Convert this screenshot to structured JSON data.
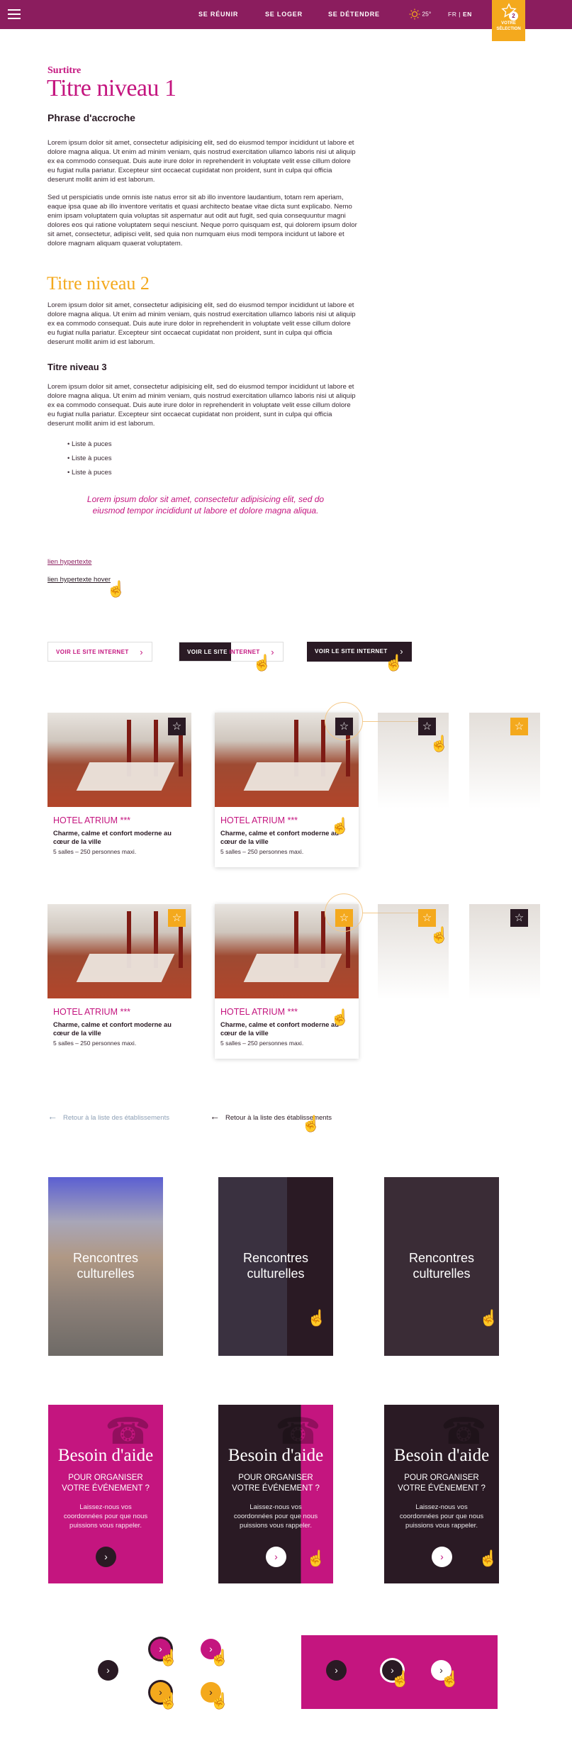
{
  "header": {
    "nav": [
      "SE RÉUNIR",
      "SE LOGER",
      "SE DÉTENDRE"
    ],
    "weather": "25°",
    "lang_fr": "FR",
    "lang_sep": "|",
    "lang_en": "EN",
    "selection_line1": "VOTRE",
    "selection_line2": "SÉLECTION",
    "selection_count": "2"
  },
  "content": {
    "surtitre": "Surtitre",
    "h1": "Titre niveau 1",
    "accroche": "Phrase d'accroche",
    "p1": "Lorem ipsum dolor sit amet, consectetur adipisicing elit, sed do eiusmod tempor incididunt ut labore et dolore magna aliqua. Ut enim ad minim veniam, quis nostrud exercitation ullamco laboris nisi ut aliquip ex ea commodo consequat. Duis aute irure dolor in reprehenderit in voluptate velit esse cillum dolore eu fugiat nulla pariatur. Excepteur sint occaecat cupidatat non proident, sunt in culpa qui officia deserunt mollit anim id est laborum.",
    "p2": "Sed ut perspiciatis unde omnis iste natus error sit ab illo inventore laudantium, totam rem aperiam, eaque ipsa quae ab illo inventore veritatis et quasi architecto beatae vitae dicta sunt explicabo. Nemo enim ipsam voluptatem quia voluptas sit aspernatur aut odit aut fugit, sed quia consequuntur magni dolores eos qui ratione voluptatem sequi nesciunt. Neque porro quisquam est, qui dolorem ipsum dolor sit amet, consectetur, adipisci velit, sed quia non numquam eius modi tempora incidunt ut labore et dolore magnam aliquam quaerat voluptatem.",
    "h2": "Titre niveau 2",
    "p3": "Lorem ipsum dolor sit amet, consectetur adipisicing elit, sed do eiusmod tempor incididunt ut labore et dolore magna aliqua. Ut enim ad minim veniam, quis nostrud exercitation ullamco laboris nisi ut aliquip ex ea commodo consequat. Duis aute irure dolor in reprehenderit in voluptate velit esse cillum dolore eu fugiat nulla pariatur. Excepteur sint occaecat cupidatat non proident, sunt in culpa qui officia deserunt mollit anim id est laborum.",
    "h3": "Titre niveau 3",
    "p4": "Lorem ipsum dolor sit amet, consectetur adipisicing elit, sed do eiusmod tempor incididunt ut labore et dolore magna aliqua. Ut enim ad minim veniam, quis nostrud exercitation ullamco laboris nisi ut aliquip ex ea commodo consequat. Duis aute irure dolor in reprehenderit in voluptate velit esse cillum dolore eu fugiat nulla pariatur. Excepteur sint occaecat cupidatat non proident, sunt in culpa qui officia deserunt mollit anim id est laborum.",
    "bullets": [
      "Liste à puces",
      "Liste à puces",
      "Liste à puces"
    ],
    "quote": "Lorem ipsum dolor sit amet, consectetur adipisicing elit, sed do eiusmod tempor incididunt ut labore et dolore magna aliqua.",
    "link": "lien hypertexte",
    "link_hover": "lien hypertexte hover"
  },
  "buttons": {
    "visit_site": "VOIR LE SITE INTERNET",
    "visit_site_part1": "VOIR LE SITE",
    "visit_site_part2": "INTERNET"
  },
  "hotel_card": {
    "title": "HOTEL ATRIUM ***",
    "desc": "Charme, calme et confort moderne au cœur de la ville",
    "meta": "5 salles – 250 personnes maxi."
  },
  "back_link": "Retour à la liste des établissements",
  "rencontres": {
    "line1": "Rencontres",
    "line2": "culturelles"
  },
  "aide": {
    "title": "Besoin d'aide",
    "sub1": "POUR ORGANISER",
    "sub2": "VOTRE ÉVÉNEMENT ?",
    "body1": "Laissez-nous vos",
    "body2": "coordonnées pour que nous",
    "body3": "puissions vous rappeler."
  },
  "colors": {
    "brand": "#8b1d5e",
    "accent_pink": "#c4157f",
    "accent_orange": "#f4a91d",
    "dark": "#2a1a24"
  }
}
